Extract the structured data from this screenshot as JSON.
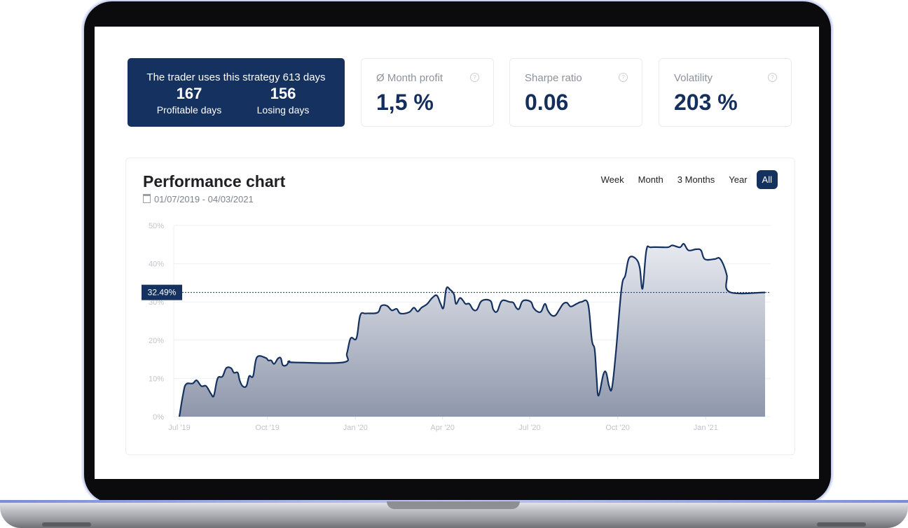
{
  "hero": {
    "line": "The trader uses this strategy 613 days",
    "profitable_value": "167",
    "profitable_label": "Profitable days",
    "losing_value": "156",
    "losing_label": "Losing days"
  },
  "stats": [
    {
      "title": "Ø Month profit",
      "value": "1,5 %"
    },
    {
      "title": "Sharpe ratio",
      "value": "0.06"
    },
    {
      "title": "Volatility",
      "value": "203 %"
    }
  ],
  "help_glyph": "?",
  "chart_card": {
    "title": "Performance chart",
    "date_range": "01/07/2019 - 04/03/2021",
    "ranges": [
      "Week",
      "Month",
      "3 Months",
      "Year",
      "All"
    ],
    "active_range": "All"
  },
  "colors": {
    "navy": "#14315f",
    "line": "#14315f",
    "fill_top": "#e8eaf0",
    "fill_bottom": "#8e97ab"
  },
  "chart_data": {
    "type": "area",
    "y_ticks": [
      "0%",
      "10%",
      "20%",
      "30%",
      "40%",
      "50%"
    ],
    "x_ticks": [
      "Jul '19",
      "Oct '19",
      "Jan '20",
      "Apr '20",
      "Jul '20",
      "Oct '20",
      "Jan '21"
    ],
    "ylim": [
      0,
      50
    ],
    "grid": true,
    "current_label": "32.49%",
    "current_value": 32.49,
    "points": [
      [
        "2019-07-01",
        0
      ],
      [
        "2019-07-05",
        6
      ],
      [
        "2019-07-08",
        8.5
      ],
      [
        "2019-07-15",
        8.7
      ],
      [
        "2019-07-19",
        9.5
      ],
      [
        "2019-07-24",
        8
      ],
      [
        "2019-07-29",
        8
      ],
      [
        "2019-08-03",
        6
      ],
      [
        "2019-08-06",
        5.5
      ],
      [
        "2019-08-10",
        10
      ],
      [
        "2019-08-15",
        10.5
      ],
      [
        "2019-08-19",
        12.7
      ],
      [
        "2019-08-24",
        12.7
      ],
      [
        "2019-08-27",
        11.5
      ],
      [
        "2019-08-31",
        11.5
      ],
      [
        "2019-09-02",
        9.5
      ],
      [
        "2019-09-05",
        8
      ],
      [
        "2019-09-09",
        8
      ],
      [
        "2019-09-12",
        10.6
      ],
      [
        "2019-09-16",
        10.6
      ],
      [
        "2019-09-20",
        15.5
      ],
      [
        "2019-09-29",
        15.4
      ],
      [
        "2019-10-02",
        14.7
      ],
      [
        "2019-10-05",
        14.7
      ],
      [
        "2019-10-08",
        13.8
      ],
      [
        "2019-10-12",
        15.2
      ],
      [
        "2019-10-15",
        15.3
      ],
      [
        "2019-10-17",
        13.5
      ],
      [
        "2019-10-21",
        13.5
      ],
      [
        "2019-10-24",
        14.5
      ],
      [
        "2019-10-28",
        14.2
      ],
      [
        "2019-12-19",
        14.2
      ],
      [
        "2019-12-23",
        16.5
      ],
      [
        "2019-12-27",
        20.5
      ],
      [
        "2020-01-02",
        20.5
      ],
      [
        "2020-01-06",
        26.5
      ],
      [
        "2020-01-12",
        27
      ],
      [
        "2020-01-24",
        27.2
      ],
      [
        "2020-01-28",
        29
      ],
      [
        "2020-02-03",
        29
      ],
      [
        "2020-02-08",
        27.8
      ],
      [
        "2020-02-13",
        28.2
      ],
      [
        "2020-02-17",
        27
      ],
      [
        "2020-02-26",
        27.3
      ],
      [
        "2020-03-02",
        28.5
      ],
      [
        "2020-03-06",
        27.5
      ],
      [
        "2020-03-10",
        28.5
      ],
      [
        "2020-03-16",
        29.5
      ],
      [
        "2020-03-21",
        31
      ],
      [
        "2020-03-26",
        31.7
      ],
      [
        "2020-03-30",
        29.5
      ],
      [
        "2020-04-02",
        28.5
      ],
      [
        "2020-04-05",
        33.5
      ],
      [
        "2020-04-09",
        33.2
      ],
      [
        "2020-04-13",
        32
      ],
      [
        "2020-04-15",
        29.5
      ],
      [
        "2020-04-19",
        31
      ],
      [
        "2020-04-22",
        30.5
      ],
      [
        "2020-04-25",
        29.5
      ],
      [
        "2020-04-29",
        29.5
      ],
      [
        "2020-05-03",
        28
      ],
      [
        "2020-05-07",
        28
      ],
      [
        "2020-05-12",
        30.3
      ],
      [
        "2020-05-21",
        30.3
      ],
      [
        "2020-05-24",
        28
      ],
      [
        "2020-05-28",
        27.5
      ],
      [
        "2020-06-02",
        30.3
      ],
      [
        "2020-06-10",
        30
      ],
      [
        "2020-06-14",
        29.8
      ],
      [
        "2020-06-17",
        28.5
      ],
      [
        "2020-06-20",
        28.2
      ],
      [
        "2020-06-24",
        30.3
      ],
      [
        "2020-07-02",
        30.1
      ],
      [
        "2020-07-05",
        28.5
      ],
      [
        "2020-07-09",
        27.5
      ],
      [
        "2020-07-13",
        27.5
      ],
      [
        "2020-07-17",
        29.5
      ],
      [
        "2020-07-20",
        27.8
      ],
      [
        "2020-07-24",
        26.5
      ],
      [
        "2020-07-28",
        26.5
      ],
      [
        "2020-08-01",
        28
      ],
      [
        "2020-08-05",
        29.5
      ],
      [
        "2020-08-09",
        29.8
      ],
      [
        "2020-08-13",
        28.8
      ],
      [
        "2020-08-19",
        29.5
      ],
      [
        "2020-08-24",
        30
      ],
      [
        "2020-08-31",
        29.5
      ],
      [
        "2020-09-04",
        20
      ],
      [
        "2020-09-07",
        17.5
      ],
      [
        "2020-09-09",
        10
      ],
      [
        "2020-09-11",
        5.5
      ],
      [
        "2020-09-16",
        11
      ],
      [
        "2020-09-19",
        11.5
      ],
      [
        "2020-09-22",
        8
      ],
      [
        "2020-09-25",
        7.5
      ],
      [
        "2020-09-29",
        16.5
      ],
      [
        "2020-10-05",
        33.5
      ],
      [
        "2020-10-09",
        37
      ],
      [
        "2020-10-13",
        41.5
      ],
      [
        "2020-10-20",
        41.3
      ],
      [
        "2020-10-24",
        39
      ],
      [
        "2020-10-27",
        33.5
      ],
      [
        "2020-10-31",
        43.5
      ],
      [
        "2020-11-05",
        44.3
      ],
      [
        "2020-11-22",
        44.3
      ],
      [
        "2020-11-27",
        44.8
      ],
      [
        "2020-12-05",
        44.3
      ],
      [
        "2020-12-09",
        45.2
      ],
      [
        "2020-12-14",
        43.5
      ],
      [
        "2020-12-22",
        43.8
      ],
      [
        "2020-12-27",
        43.5
      ],
      [
        "2020-12-31",
        41.2
      ],
      [
        "2021-01-10",
        41.2
      ],
      [
        "2021-01-15",
        41.5
      ],
      [
        "2021-01-19",
        40
      ],
      [
        "2021-01-23",
        37
      ],
      [
        "2021-01-26",
        32.6
      ],
      [
        "2021-03-04",
        32.49
      ]
    ]
  }
}
